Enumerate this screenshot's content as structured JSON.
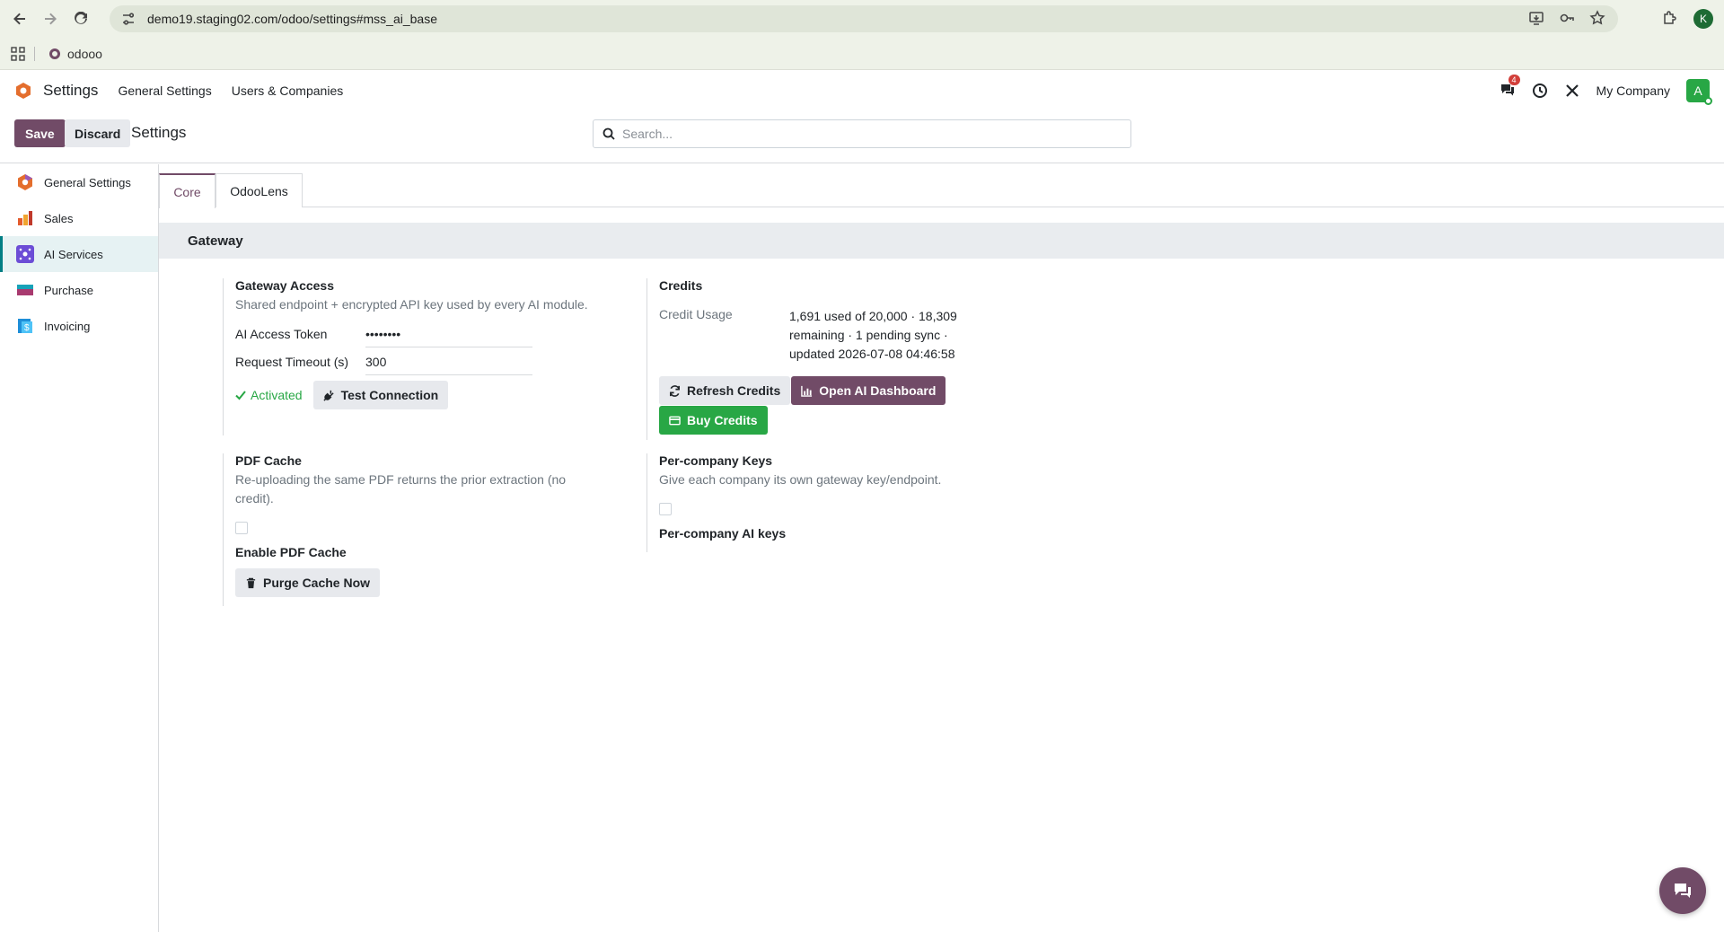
{
  "browser": {
    "url": "demo19.staging02.com/odoo/settings#mss_ai_base",
    "bookmark_label": "odooo",
    "profile_initial": "K"
  },
  "navbar": {
    "app_name": "Settings",
    "menus": [
      "General Settings",
      "Users & Companies"
    ],
    "chat_badge": "4",
    "company": "My Company",
    "avatar_initial": "A"
  },
  "control_panel": {
    "save_label": "Save",
    "discard_label": "Discard",
    "title": "Settings",
    "search_placeholder": "Search..."
  },
  "sidebar": {
    "items": [
      {
        "label": "General Settings",
        "icon": "odoo-settings-icon",
        "color": "#e46e2d"
      },
      {
        "label": "Sales",
        "icon": "sales-chart-icon",
        "color": "#e45c2d"
      },
      {
        "label": "AI Services",
        "icon": "ai-sparkle-icon",
        "color": "#6c4dd6"
      },
      {
        "label": "Purchase",
        "icon": "purchase-card-icon",
        "color": "#17a2b8"
      },
      {
        "label": "Invoicing",
        "icon": "invoice-icon",
        "color": "#1e8ed8"
      }
    ],
    "active_index": 2
  },
  "tabs": [
    "Core",
    "OdooLens"
  ],
  "section": {
    "title": "Gateway"
  },
  "gateway_access": {
    "title": "Gateway Access",
    "description": "Shared endpoint + encrypted API key used by every AI module.",
    "token_label": "AI Access Token",
    "token_value": "••••••••",
    "timeout_label": "Request Timeout (s)",
    "timeout_value": "300",
    "status": "Activated",
    "test_button": "Test Connection"
  },
  "credits": {
    "title": "Credits",
    "usage_label": "Credit Usage",
    "usage_text": "1,691 used of 20,000 · 18,309 remaining · 1 pending sync · updated 2026-07-08 04:46:58",
    "refresh_button": "Refresh Credits",
    "dashboard_button": "Open AI Dashboard",
    "buy_button": "Buy Credits"
  },
  "pdf_cache": {
    "title": "PDF Cache",
    "description": "Re-uploading the same PDF returns the prior extraction (no credit).",
    "checkbox_label": "Enable PDF Cache",
    "checked": false,
    "purge_button": "Purge Cache Now"
  },
  "per_company": {
    "title": "Per-company Keys",
    "description": "Give each company its own gateway key/endpoint.",
    "checkbox_label": "Per-company AI keys",
    "checked": false
  },
  "colors": {
    "brand": "#714b67",
    "success": "#28a745",
    "accent": "#017e84"
  }
}
